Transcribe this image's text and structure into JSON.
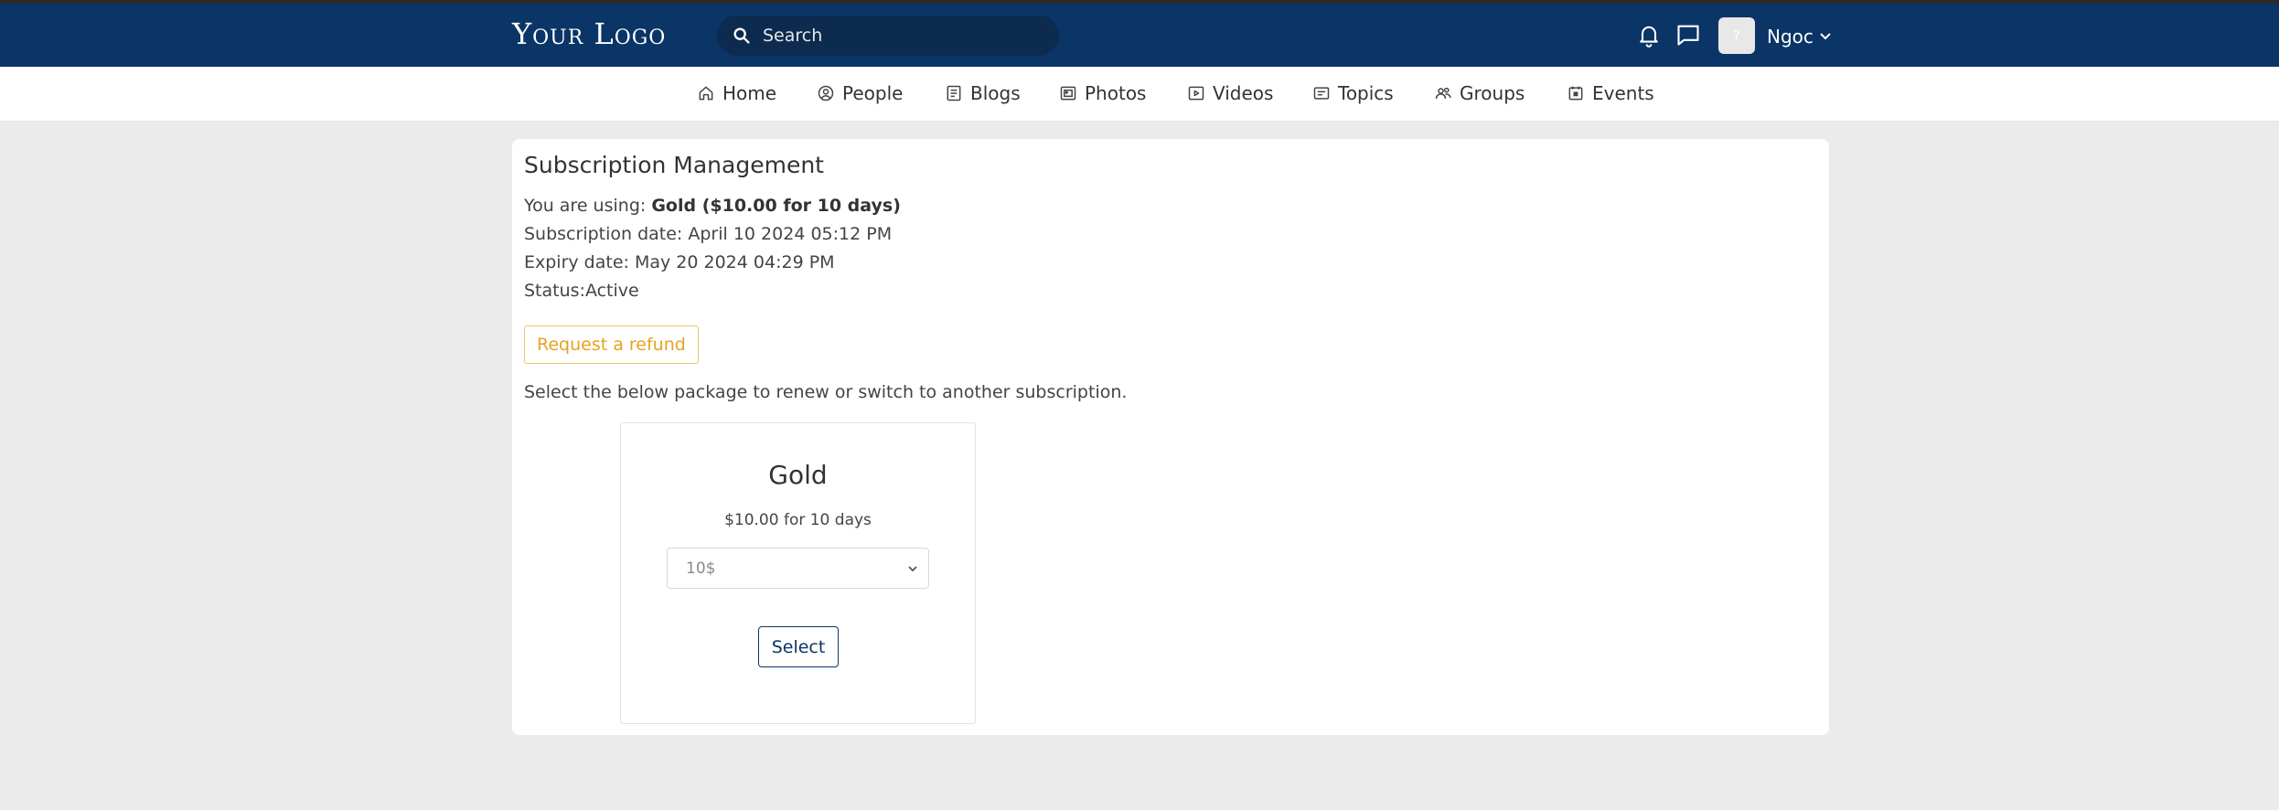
{
  "header": {
    "logo_text": "Your Logo",
    "search_placeholder": "Search",
    "user_name": "Ngoc",
    "avatar_text": "?"
  },
  "nav": {
    "items": [
      {
        "label": "Home",
        "icon": "home-icon"
      },
      {
        "label": "People",
        "icon": "user-circle-icon"
      },
      {
        "label": "Blogs",
        "icon": "document-icon"
      },
      {
        "label": "Photos",
        "icon": "image-icon"
      },
      {
        "label": "Videos",
        "icon": "video-icon"
      },
      {
        "label": "Topics",
        "icon": "topic-icon"
      },
      {
        "label": "Groups",
        "icon": "group-icon"
      },
      {
        "label": "Events",
        "icon": "calendar-icon"
      }
    ]
  },
  "subscription": {
    "title": "Subscription Management",
    "using_label": "You are using: ",
    "using_value": "Gold ($10.00 for 10 days)",
    "subscription_date": "Subscription date: April 10 2024 05:12 PM",
    "expiry_date": "Expiry date: May 20 2024 04:29 PM",
    "status": "Status:Active",
    "refund_label": "Request a refund",
    "select_note": "Select the below package to renew or switch to another subscription."
  },
  "package": {
    "name": "Gold",
    "price": "$10.00 for 10 days",
    "selected_option": "10$",
    "select_label": "Select"
  },
  "colors": {
    "header_bg": "#0a3566",
    "refund_accent": "#e7a21e",
    "page_bg": "#ebebeb"
  }
}
